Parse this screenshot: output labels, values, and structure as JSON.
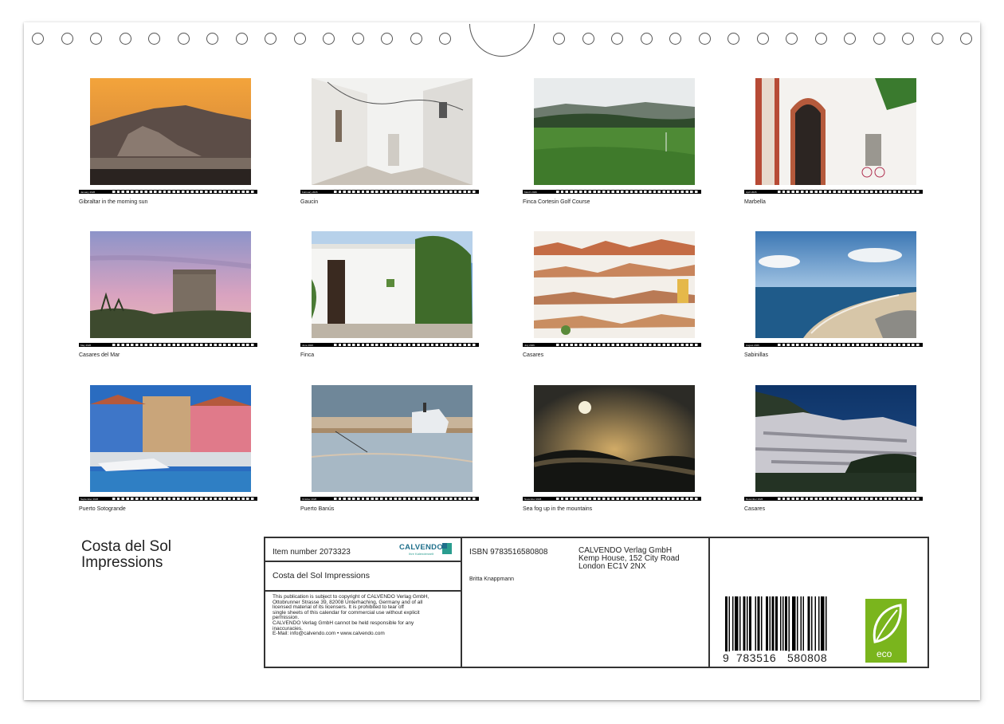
{
  "months": [
    {
      "id": "jan",
      "month_label": "January 2026",
      "caption": "Gibraltar in the morning sun",
      "scene": "sunset-rock"
    },
    {
      "id": "feb",
      "month_label": "February 2026",
      "caption": "Gaucin",
      "scene": "white-street"
    },
    {
      "id": "mar",
      "month_label": "March 2026",
      "caption": "Finca Cortesin Golf Course",
      "scene": "golf-course"
    },
    {
      "id": "apr",
      "month_label": "April 2026",
      "caption": "Marbella",
      "scene": "white-doorway"
    },
    {
      "id": "may",
      "month_label": "May 2026",
      "caption": "Casares del Mar",
      "scene": "tower-dusk"
    },
    {
      "id": "jun",
      "month_label": "June 2026",
      "caption": "Finca",
      "scene": "white-finca"
    },
    {
      "id": "jul",
      "month_label": "July 2026",
      "caption": "Casares",
      "scene": "white-village"
    },
    {
      "id": "aug",
      "month_label": "August 2026",
      "caption": "Sabinillas",
      "scene": "beach"
    },
    {
      "id": "sep",
      "month_label": "September 2026",
      "caption": "Puerto Sotogrande",
      "scene": "harbour-houses"
    },
    {
      "id": "oct",
      "month_label": "October 2026",
      "caption": "Puerto Banús",
      "scene": "harbour-boat"
    },
    {
      "id": "nov",
      "month_label": "November 2026",
      "caption": "Sea fog up in the mountains",
      "scene": "fog-moon"
    },
    {
      "id": "dec",
      "month_label": "December 2026",
      "caption": "Casares",
      "scene": "village-night"
    }
  ],
  "title_line1": "Costa del Sol",
  "title_line2": "Impressions",
  "info": {
    "item_number": "Item number 2073323",
    "brand": "CALVENDO",
    "brand_tagline": "Ihre Kalenderwelt",
    "product_title": "Costa del Sol Impressions",
    "isbn": "ISBN 9783516580808",
    "author": "Britta Knappmann",
    "publisher_lines": [
      "CALVENDO Verlag GmbH",
      "Kemp House, 152 City Road",
      "London EC1V 2NX"
    ],
    "legal_lines": [
      "This publication is subject to copyright of CALVENDO Verlag GmbH,",
      "Ottobrunner Strasse 39, 82008 Unterhaching, Germany and of all",
      "licensed material of its licensers. It is prohibited to tear off",
      "single sheets of this calendar for commercial use without explicit",
      "permission.",
      "CALVENDO Verlag GmbH cannot be held responsible for any",
      "inaccuracies.",
      "E-Mail: info@calvendo.com • www.calvendo.com"
    ],
    "barcode_digits": [
      "9",
      "783516",
      "580808"
    ],
    "eco_label": "eco"
  },
  "colors": {
    "eco_green": "#7ab51d",
    "brand_green": "#2e8b57",
    "brand_teal": "#2a9d8f"
  }
}
